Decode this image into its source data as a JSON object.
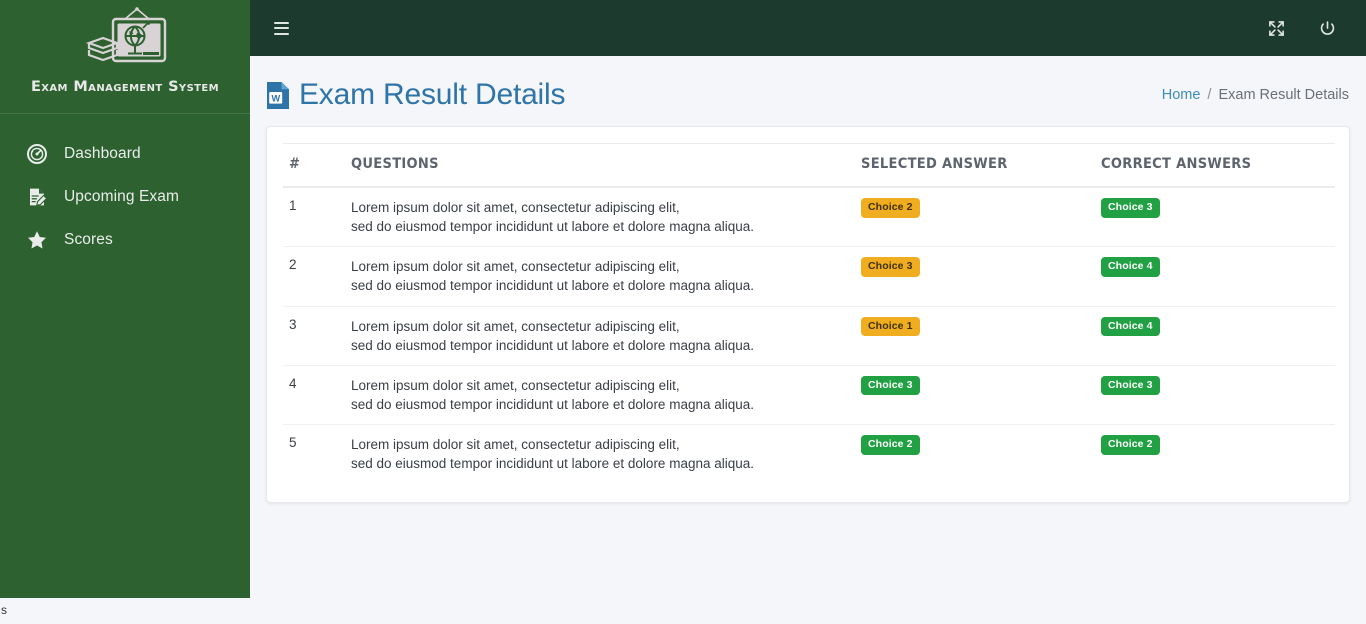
{
  "brand": {
    "name": "Exam Management System",
    "logo_icon": "chalkboard-globe-books-icon"
  },
  "sidebar": {
    "items": [
      {
        "label": "Dashboard",
        "icon": "tachometer-icon"
      },
      {
        "label": "Upcoming Exam",
        "icon": "document-edit-icon"
      },
      {
        "label": "Scores",
        "icon": "star-icon"
      }
    ]
  },
  "topbar": {
    "menu_toggle_icon": "hamburger-icon",
    "fullscreen_icon": "expand-arrows-icon",
    "logout_icon": "power-icon"
  },
  "page": {
    "title": "Exam Result Details",
    "title_icon": "word-document-icon",
    "stray_text": "s"
  },
  "breadcrumb": {
    "home": "Home",
    "separator": "/",
    "current": "Exam Result Details"
  },
  "table": {
    "headers": {
      "num": "#",
      "questions": "QUESTIONS",
      "selected": "SELECTED ANSWER",
      "correct": "CORRECT ANSWERS"
    },
    "rows": [
      {
        "num": "1",
        "q_line1": "Lorem ipsum dolor sit amet, consectetur adipiscing elit,",
        "q_line2": "sed do eiusmod tempor incididunt ut labore et dolore magna aliqua.",
        "selected": "Choice 2",
        "selected_state": "wrong",
        "correct": "Choice 3"
      },
      {
        "num": "2",
        "q_line1": "Lorem ipsum dolor sit amet, consectetur adipiscing elit,",
        "q_line2": "sed do eiusmod tempor incididunt ut labore et dolore magna aliqua.",
        "selected": "Choice 3",
        "selected_state": "wrong",
        "correct": "Choice 4"
      },
      {
        "num": "3",
        "q_line1": "Lorem ipsum dolor sit amet, consectetur adipiscing elit,",
        "q_line2": "sed do eiusmod tempor incididunt ut labore et dolore magna aliqua.",
        "selected": "Choice 1",
        "selected_state": "wrong",
        "correct": "Choice 4"
      },
      {
        "num": "4",
        "q_line1": "Lorem ipsum dolor sit amet, consectetur adipiscing elit,",
        "q_line2": "sed do eiusmod tempor incididunt ut labore et dolore magna aliqua.",
        "selected": "Choice 3",
        "selected_state": "correct",
        "correct": "Choice 3"
      },
      {
        "num": "5",
        "q_line1": "Lorem ipsum dolor sit amet, consectetur adipiscing elit,",
        "q_line2": "sed do eiusmod tempor incididunt ut labore et dolore magna aliqua.",
        "selected": "Choice 2",
        "selected_state": "correct",
        "correct": "Choice 2"
      }
    ]
  },
  "colors": {
    "sidebar_green": "#2d6230",
    "topbar_green": "#1d3a2f",
    "page_background": "#f4f6f9",
    "title_blue": "#2e74a8",
    "link_blue": "#3c8dbc",
    "badge_warning": "#f0ad1f",
    "badge_success": "#22a044"
  }
}
